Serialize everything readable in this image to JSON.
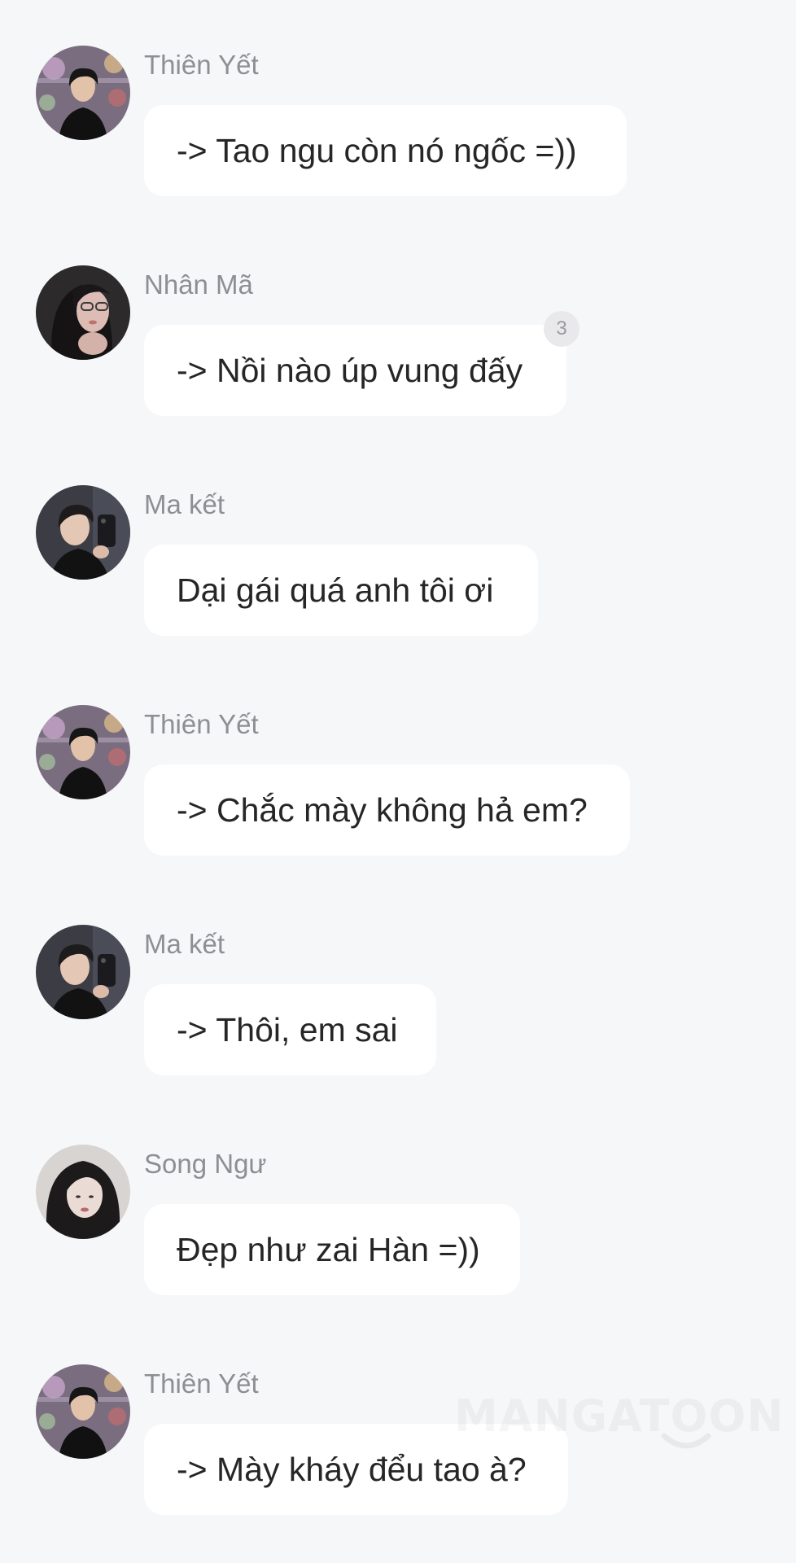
{
  "messages": [
    {
      "sender": "Thiên Yết",
      "avatar": "avatar-thien-yet",
      "text": "-> Tao ngu còn nó ngốc =))"
    },
    {
      "sender": "Nhân Mã",
      "avatar": "avatar-nhan-ma",
      "text": "-> Nồi nào úp vung đấy",
      "badge": "3"
    },
    {
      "sender": "Ma kết",
      "avatar": "avatar-ma-ket",
      "text": "Dại gái quá anh tôi ơi"
    },
    {
      "sender": "Thiên Yết",
      "avatar": "avatar-thien-yet",
      "text": "-> Chắc mày không hả em?"
    },
    {
      "sender": "Ma kết",
      "avatar": "avatar-ma-ket",
      "text": "-> Thôi, em sai"
    },
    {
      "sender": "Song Ngư",
      "avatar": "avatar-song-ngu",
      "text": "Đẹp như zai Hàn =))"
    },
    {
      "sender": "Thiên Yết",
      "avatar": "avatar-thien-yet",
      "text": "-> Mày kháy đểu tao à?"
    }
  ],
  "watermark": "MANGATOON",
  "colors": {
    "background": "#f6f7f9",
    "bubble": "#ffffff",
    "sender_name": "#8e8e93",
    "message_text": "#262626",
    "badge_bg": "#e9e9ec"
  }
}
